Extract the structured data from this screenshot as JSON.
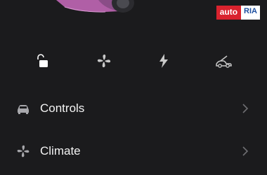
{
  "watermark": {
    "brand_left": "auto",
    "brand_right": "RIA"
  },
  "quick_controls": [
    {
      "icon": "unlock-icon"
    },
    {
      "icon": "fan-icon"
    },
    {
      "icon": "lightning-icon"
    },
    {
      "icon": "frunk-icon"
    }
  ],
  "menu": {
    "items": [
      {
        "label": "Controls",
        "icon": "car-icon"
      },
      {
        "label": "Climate",
        "icon": "fan-icon"
      }
    ]
  },
  "colors": {
    "background": "#1b1b1d",
    "icon": "#c9c9c9",
    "chevron": "#6e6e72",
    "car_accent": "#b05fa6"
  }
}
